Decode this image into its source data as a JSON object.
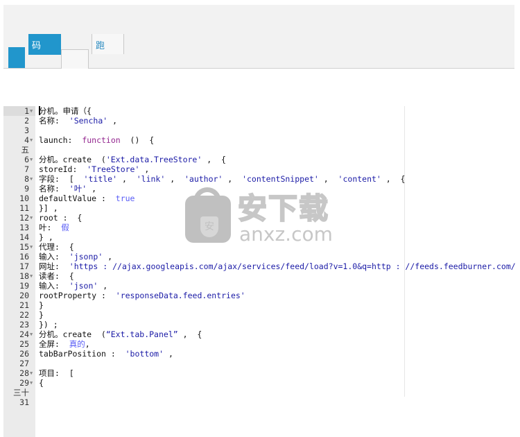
{
  "tabs": [
    {
      "label": "",
      "active": true
    },
    {
      "label": "码",
      "active": true
    },
    {
      "label": "",
      "active": false
    },
    {
      "label": "跑",
      "active": false
    }
  ],
  "editor": {
    "line_numbers": [
      "1",
      "2",
      "3",
      "4",
      "五",
      "6",
      "7",
      "8",
      "9",
      "10",
      "11",
      "12",
      "13",
      "14",
      "15",
      "16",
      "17",
      "18",
      "19",
      "20",
      "21",
      "22",
      "23",
      "24",
      "25",
      "26",
      "27",
      "28",
      "29",
      "三十",
      "31"
    ],
    "fold_lines": [
      1,
      4,
      6,
      8,
      12,
      15,
      18,
      24,
      28,
      29
    ],
    "fold_icon": "▼",
    "lines": [
      [
        {
          "t": "分机。申请（{"
        }
      ],
      [
        {
          "t": "名称:  "
        },
        {
          "t": "'Sencha'",
          "c": "str"
        },
        {
          "t": " ,"
        }
      ],
      [],
      [
        {
          "t": "launch:  "
        },
        {
          "t": "function",
          "c": "kw"
        },
        {
          "t": "  ()  {"
        }
      ],
      [],
      [
        {
          "t": "分机。create  ("
        },
        {
          "t": "'Ext.data.TreeStore'",
          "c": "str"
        },
        {
          "t": " ,  {"
        }
      ],
      [
        {
          "t": "storeId:  "
        },
        {
          "t": "'TreeStore'",
          "c": "str"
        },
        {
          "t": " ,"
        }
      ],
      [
        {
          "t": "字段:  [  "
        },
        {
          "t": "'title'",
          "c": "str"
        },
        {
          "t": " ,  "
        },
        {
          "t": "'link'",
          "c": "str"
        },
        {
          "t": " ,  "
        },
        {
          "t": "'author'",
          "c": "str"
        },
        {
          "t": " ,  "
        },
        {
          "t": "'contentSnippet'",
          "c": "str"
        },
        {
          "t": " ,  "
        },
        {
          "t": "'content'",
          "c": "str"
        },
        {
          "t": " ,  {"
        }
      ],
      [
        {
          "t": "名称:  "
        },
        {
          "t": "'叶'",
          "c": "str"
        },
        {
          "t": " ,"
        }
      ],
      [
        {
          "t": "defaultValue :  "
        },
        {
          "t": "true",
          "c": "cst"
        }
      ],
      [
        {
          "t": "}] ,"
        }
      ],
      [
        {
          "t": "root :  {"
        }
      ],
      [
        {
          "t": "叶:  "
        },
        {
          "t": "假",
          "c": "cst"
        }
      ],
      [
        {
          "t": "} ,"
        }
      ],
      [
        {
          "t": "代理:  {"
        }
      ],
      [
        {
          "t": "输入:  "
        },
        {
          "t": "'jsonp'",
          "c": "str"
        },
        {
          "t": " ,"
        }
      ],
      [
        {
          "t": "网址:  "
        },
        {
          "t": "'https : //ajax.googleapis.com/ajax/services/feed/load?v=1.0&q=http : //feeds.feedburner.com/",
          "c": "str"
        }
      ],
      [
        {
          "t": "读者:  {"
        }
      ],
      [
        {
          "t": "输入:  "
        },
        {
          "t": "'json'",
          "c": "str"
        },
        {
          "t": " ,"
        }
      ],
      [
        {
          "t": "rootProperty :  "
        },
        {
          "t": "'responseData.feed.entries'",
          "c": "str"
        }
      ],
      [
        {
          "t": "}"
        }
      ],
      [
        {
          "t": "}"
        }
      ],
      [
        {
          "t": "}) ;"
        }
      ],
      [
        {
          "t": "分机。create  ("
        },
        {
          "t": "“Ext.tab.Panel”",
          "c": "str"
        },
        {
          "t": " ,  {"
        }
      ],
      [
        {
          "t": "全屏:  "
        },
        {
          "t": "真的",
          "c": "cst"
        },
        {
          "t": ","
        }
      ],
      [
        {
          "t": "tabBarPosition :  "
        },
        {
          "t": "'bottom'",
          "c": "str"
        },
        {
          "t": " ,"
        }
      ],
      [],
      [
        {
          "t": "项目:  ["
        }
      ],
      [
        {
          "t": "{"
        }
      ],
      [],
      []
    ]
  },
  "watermark": {
    "title": "安下载",
    "url": "anxz.com",
    "badge": "安"
  }
}
